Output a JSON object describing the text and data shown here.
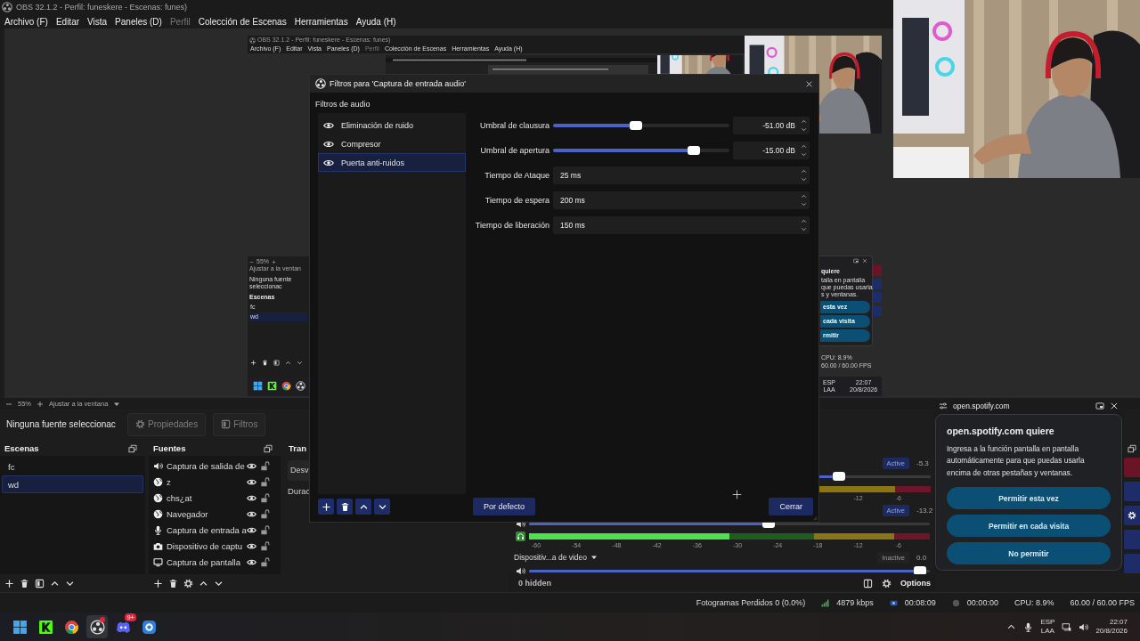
{
  "window": {
    "title": "OBS 32.1.2 - Perfil: funeskere - Escenas: funes)"
  },
  "menu": [
    {
      "label": "Archivo (F)",
      "disabled": false
    },
    {
      "label": "Editar",
      "disabled": false
    },
    {
      "label": "Vista",
      "disabled": false
    },
    {
      "label": "Paneles (D)",
      "disabled": false
    },
    {
      "label": "Perfil",
      "disabled": true
    },
    {
      "label": "Colección de Escenas",
      "disabled": false
    },
    {
      "label": "Herramientas",
      "disabled": false
    },
    {
      "label": "Ayuda (H)",
      "disabled": false
    }
  ],
  "preview": {
    "capture": {
      "title": "OBS 32.1.2 - Perfil: funeskere - Escenas: funes)",
      "menu": [
        {
          "label": "Archivo (F)",
          "disabled": false
        },
        {
          "label": "Editar",
          "disabled": false
        },
        {
          "label": "Vista",
          "disabled": false
        },
        {
          "label": "Paneles (D)",
          "disabled": false
        },
        {
          "label": "Perfil",
          "disabled": true
        },
        {
          "label": "Colección de Escenas",
          "disabled": false
        },
        {
          "label": "Herramientas",
          "disabled": false
        },
        {
          "label": "Ayuda (H)",
          "disabled": false
        }
      ],
      "zoom": "55%",
      "fit": "Ajustar a la ventan",
      "source": "Ninguna fuente seleccionac",
      "scenes_title": "Escenas",
      "scenes": [
        {
          "label": "fc",
          "selected": false
        },
        {
          "label": "wd",
          "selected": true
        }
      ],
      "popup_heading": "quiere",
      "popup_lines": [
        "talla en pantalla",
        "que puedas usarla",
        "s y ventanas."
      ],
      "popup_buttons": [
        "esta vez",
        "cada visita",
        "rmitir"
      ],
      "status": [
        "CPU: 8.9%",
        "60.00 / 60.00 FPS"
      ],
      "lang": [
        "ESP",
        "LAA"
      ],
      "time": "22:07",
      "date": "20/8/2026"
    }
  },
  "zoom_bar": {
    "zoom": "55%",
    "fit": "Ajustar a la ventana"
  },
  "context_bar": {
    "source": "Ninguna fuente seleccionac",
    "buttons": [
      {
        "label": "Propiedades",
        "kind": "gear"
      },
      {
        "label": "Filtros",
        "kind": "filter"
      }
    ]
  },
  "scenes": {
    "title": "Escenas",
    "items": [
      {
        "label": "fc",
        "selected": false
      },
      {
        "label": "wd",
        "selected": true
      }
    ]
  },
  "sources": {
    "title": "Fuentes",
    "items": [
      {
        "label": "Captura de salida de",
        "kind": "speaker",
        "visible": true,
        "locked": false
      },
      {
        "label": "z",
        "kind": "globe",
        "visible": true,
        "locked": false
      },
      {
        "label": "chs¿at",
        "kind": "globe",
        "visible": true,
        "locked": false
      },
      {
        "label": "Navegador",
        "kind": "globe",
        "visible": true,
        "locked": false
      },
      {
        "label": "Captura de entrada a",
        "kind": "mic",
        "visible": true,
        "locked": false
      },
      {
        "label": "Dispositivo de captu",
        "kind": "camera",
        "visible": true,
        "locked": false
      },
      {
        "label": "Captura de pantalla",
        "kind": "monitor",
        "visible": true,
        "locked": false
      }
    ]
  },
  "transitions": {
    "title": "Tran",
    "select": "Desv",
    "duration": "Durac"
  },
  "mixer": {
    "channels": [
      {
        "active": true,
        "status": "Active",
        "reading": "-5.3",
        "volume": {
          "level": 0.78
        },
        "ticks": [
          "-12",
          "-6"
        ]
      },
      {
        "active": true,
        "status": "Active",
        "reading": "-13.2",
        "volume": {
          "level": 0.6
        },
        "meter": {
          "level": 0.5
        },
        "ticks": [
          "-60",
          "-54",
          "-48",
          "-42",
          "-36",
          "-30",
          "-24",
          "-18",
          "-12",
          "-6"
        ]
      },
      {
        "active": false,
        "name": "Dispositiv...a de video",
        "status": "Inactive",
        "reading": "0.0",
        "volume": {
          "level": 0.99
        }
      }
    ],
    "footer": {
      "hidden": "0 hidden",
      "options": "Options"
    }
  },
  "dialog": {
    "title": "Filtros para 'Captura de entrada audio'",
    "section": "Filtros de audio",
    "filters": [
      {
        "label": "Eliminación de ruido",
        "enabled": true,
        "selected": false
      },
      {
        "label": "Compresor",
        "enabled": true,
        "selected": false
      },
      {
        "label": "Puerta anti-ruidos",
        "enabled": true,
        "selected": true
      }
    ],
    "properties": [
      {
        "kind": "slider",
        "label": "Umbral de clausura",
        "level": 0.47,
        "value": "-51.00 dB"
      },
      {
        "kind": "slider",
        "label": "Umbral de apertura",
        "level": 0.82,
        "value": "-15.00 dB"
      },
      {
        "kind": "number",
        "label": "Tiempo de Ataque",
        "value": "25 ms"
      },
      {
        "kind": "number",
        "label": "Tiempo de espera",
        "value": "200 ms"
      },
      {
        "kind": "number",
        "label": "Tiempo de liberación",
        "value": "150 ms"
      }
    ],
    "defaults_button": "Por defecto",
    "close_button": "Cerrar"
  },
  "popup": {
    "site": "open.spotify.com",
    "heading": "open.spotify.com quiere",
    "body": "Ingresa a la función pantalla en pantalla automáticamente para que puedas usarla encima de otras pestañas y ventanas.",
    "buttons": [
      "Permitir esta vez",
      "Permitir en cada visita",
      "No permitir"
    ]
  },
  "status_bar": {
    "dropped": "Fotogramas Perdidos 0 (0.0%)",
    "bitrate": "4879 kbps",
    "stream_time": "00:08:09",
    "record_time": "00:00:00",
    "cpu": "CPU: 8.9%",
    "fps": "60.00 / 60.00 FPS"
  },
  "taskbar": {
    "apps": [
      {
        "kind": "start",
        "selected": false
      },
      {
        "kind": "kick",
        "selected": false
      },
      {
        "kind": "chrome",
        "selected": false
      },
      {
        "kind": "obs",
        "selected": true,
        "alert": true
      },
      {
        "kind": "discord",
        "selected": false,
        "badge": "9+"
      },
      {
        "kind": "assistant",
        "selected": false
      }
    ],
    "lang": [
      "ESP",
      "LAA"
    ],
    "time": "22:07",
    "date": "20/8/2026"
  }
}
